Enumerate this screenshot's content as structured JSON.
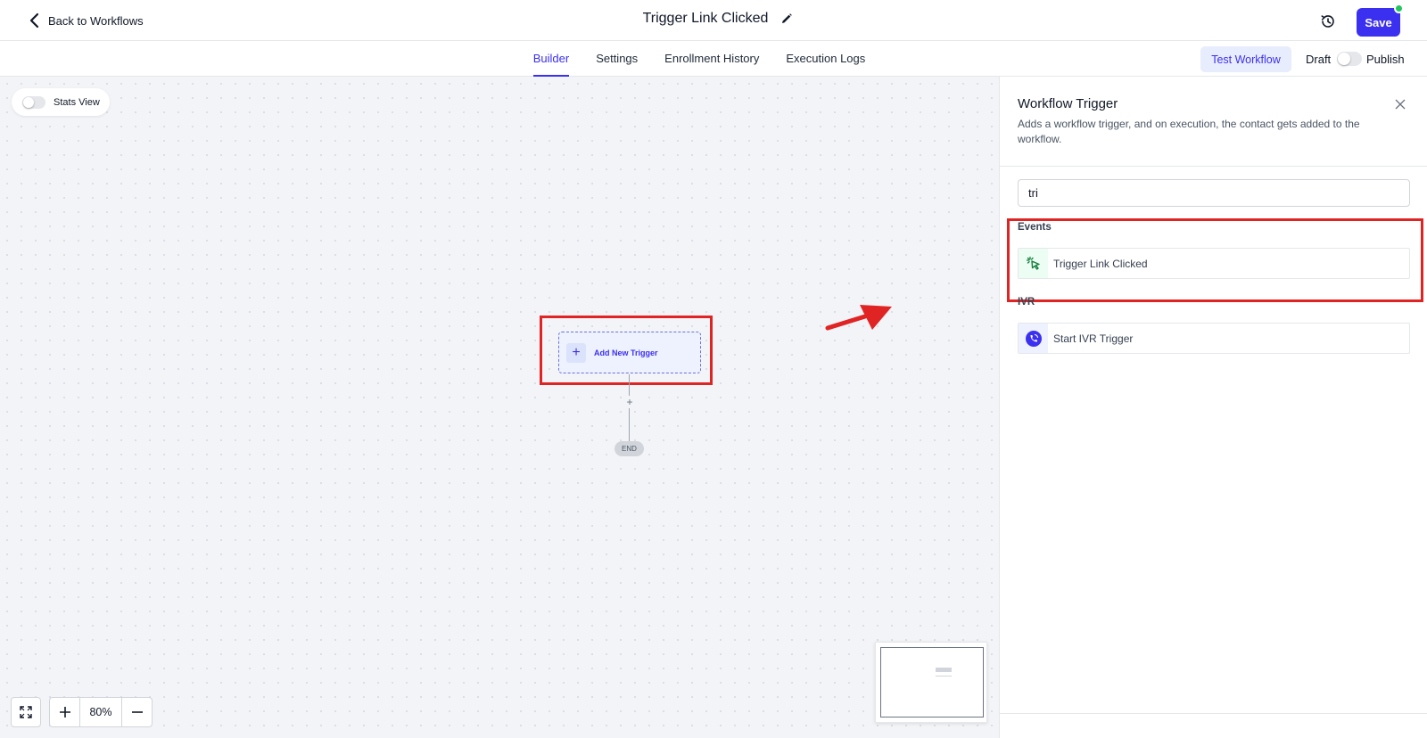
{
  "header": {
    "back_label": "Back to Workflows",
    "title": "Trigger Link Clicked",
    "save_label": "Save",
    "save_color": "#3b2ff0",
    "status_dot_color": "#22c55e"
  },
  "tabs": [
    {
      "label": "Builder",
      "active": true
    },
    {
      "label": "Settings",
      "active": false
    },
    {
      "label": "Enrollment History",
      "active": false
    },
    {
      "label": "Execution Logs",
      "active": false
    }
  ],
  "actions": {
    "test_label": "Test Workflow",
    "draft_label": "Draft",
    "publish_label": "Publish",
    "published": false
  },
  "canvas": {
    "stats_label": "Stats View",
    "stats_on": false,
    "trigger_node_label": "Add New Trigger",
    "add_step_symbol": "+",
    "end_label": "END",
    "zoom": "80%",
    "highlight_color": "#e02424"
  },
  "panel": {
    "title": "Workflow Trigger",
    "description": "Adds a workflow trigger, and on execution, the contact gets added to the workflow.",
    "search_value": "tri",
    "groups": [
      {
        "label": "Events",
        "items": [
          {
            "label": "Trigger Link Clicked",
            "icon": "cursor-click-icon"
          }
        ]
      },
      {
        "label": "IVR",
        "items": [
          {
            "label": "Start IVR Trigger",
            "icon": "phone-call-icon"
          }
        ]
      }
    ]
  }
}
